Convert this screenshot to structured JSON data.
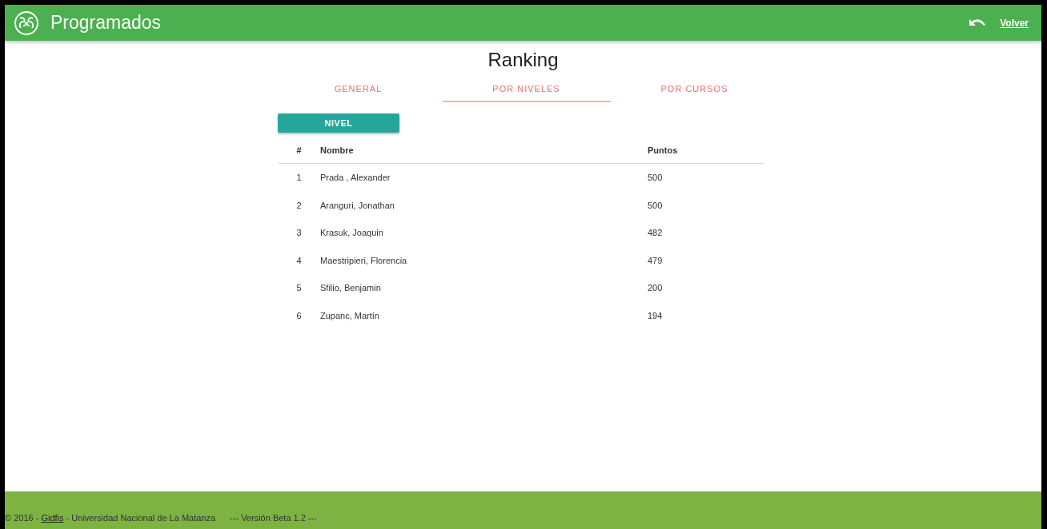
{
  "header": {
    "title": "Programados",
    "back_link": "Volver"
  },
  "page_title": "Ranking",
  "tabs": [
    {
      "label": "GENERAL",
      "selected": false
    },
    {
      "label": "POR NIVELES",
      "selected": true
    },
    {
      "label": "POR CURSOS",
      "selected": false
    }
  ],
  "filter_button": "NIVEL",
  "table": {
    "columns": [
      "#",
      "Nombre",
      "Puntos"
    ],
    "rows": [
      [
        "1",
        "Prada , Alexander",
        "500"
      ],
      [
        "2",
        "Aranguri, Jonathan",
        "500"
      ],
      [
        "3",
        "Krasuk, Joaquin",
        "482"
      ],
      [
        "4",
        "Maestripieri, Florencia",
        "479"
      ],
      [
        "5",
        "Sfilio, Benjamin",
        "200"
      ],
      [
        "6",
        "Zupanc, Martín",
        "194"
      ]
    ]
  },
  "footer": {
    "prefix": "© 2016 - ",
    "link": "Gidfis",
    "suffix": " - Universidad Nacional de La Matanza",
    "version": "--- Versión Beta 1.2 ---"
  }
}
